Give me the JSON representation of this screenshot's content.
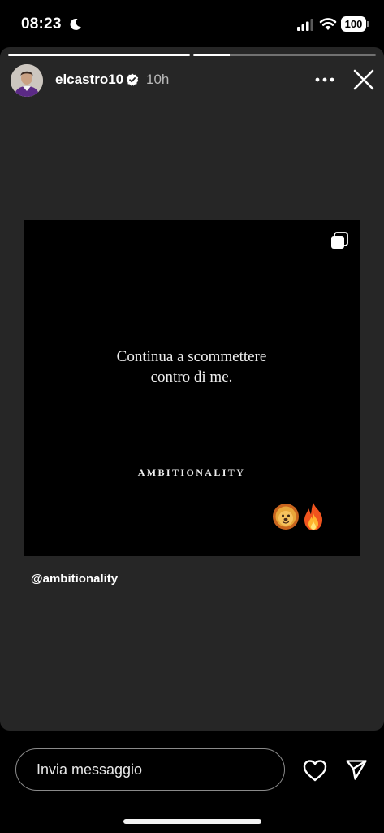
{
  "status_bar": {
    "time": "08:23",
    "battery": "100",
    "icons": [
      "moon-icon",
      "signal-icon",
      "wifi-icon",
      "battery-icon"
    ]
  },
  "story": {
    "progress": [
      1.0,
      0.2
    ],
    "username": "elcastro10",
    "verified": true,
    "time_ago": "10h",
    "icons": [
      "verified-badge-icon",
      "more-icon",
      "close-icon"
    ]
  },
  "post": {
    "quote_line1": "Continua a scommettere",
    "quote_line2": "contro di me.",
    "brand": "AMBITIONALITY",
    "stickers": [
      "lion-sticker",
      "fire-sticker"
    ],
    "carousel_icon": "carousel-icon"
  },
  "mention": "@ambitionality",
  "reply": {
    "placeholder": "Invia messaggio",
    "icons": [
      "heart-icon",
      "send-icon"
    ]
  },
  "colors": {
    "story_background": "#262626",
    "post_background": "#000000",
    "screen_background": "#000000"
  }
}
